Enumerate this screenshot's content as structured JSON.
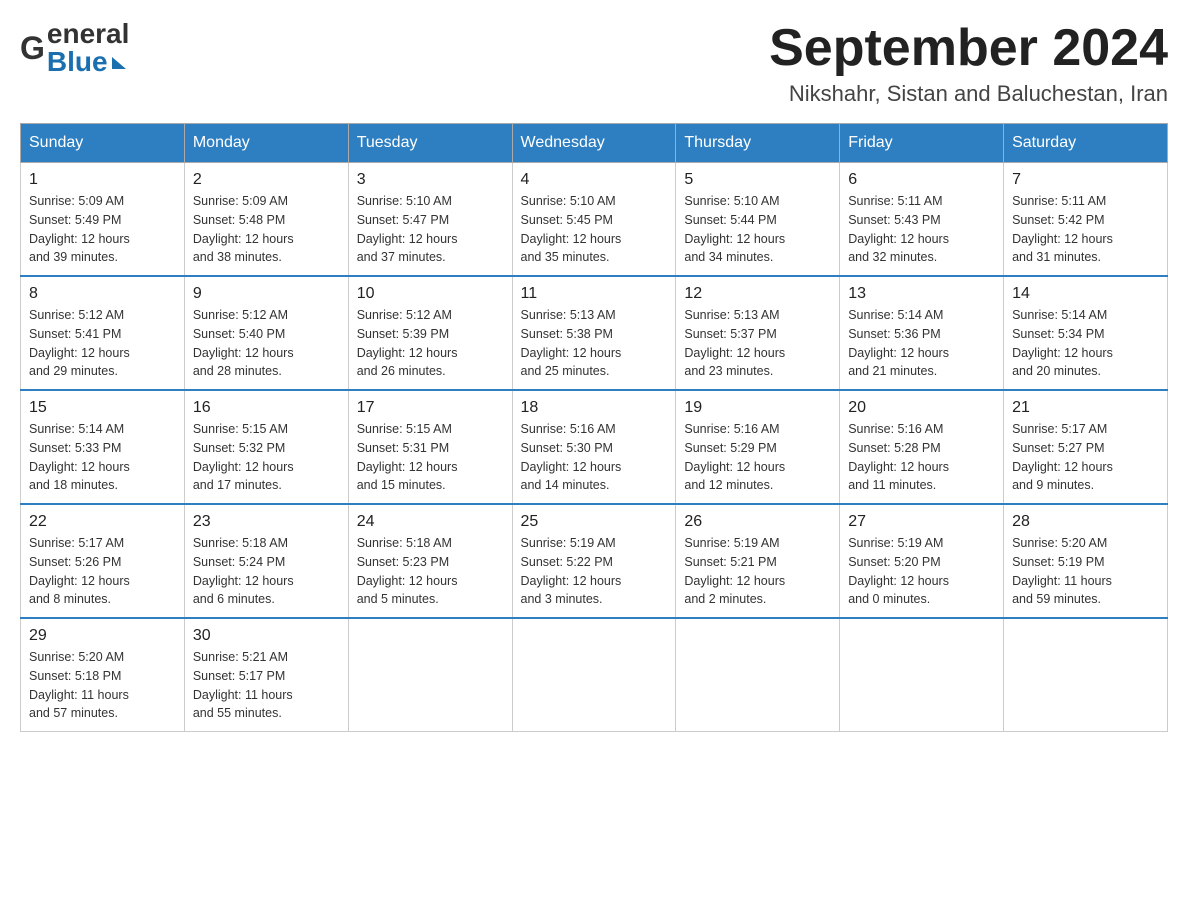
{
  "header": {
    "logo_general": "General",
    "logo_blue": "Blue",
    "title": "September 2024",
    "subtitle": "Nikshahr, Sistan and Baluchestan, Iran"
  },
  "calendar": {
    "weekdays": [
      "Sunday",
      "Monday",
      "Tuesday",
      "Wednesday",
      "Thursday",
      "Friday",
      "Saturday"
    ],
    "weeks": [
      [
        {
          "day": "1",
          "sunrise": "5:09 AM",
          "sunset": "5:49 PM",
          "daylight": "12 hours and 39 minutes."
        },
        {
          "day": "2",
          "sunrise": "5:09 AM",
          "sunset": "5:48 PM",
          "daylight": "12 hours and 38 minutes."
        },
        {
          "day": "3",
          "sunrise": "5:10 AM",
          "sunset": "5:47 PM",
          "daylight": "12 hours and 37 minutes."
        },
        {
          "day": "4",
          "sunrise": "5:10 AM",
          "sunset": "5:45 PM",
          "daylight": "12 hours and 35 minutes."
        },
        {
          "day": "5",
          "sunrise": "5:10 AM",
          "sunset": "5:44 PM",
          "daylight": "12 hours and 34 minutes."
        },
        {
          "day": "6",
          "sunrise": "5:11 AM",
          "sunset": "5:43 PM",
          "daylight": "12 hours and 32 minutes."
        },
        {
          "day": "7",
          "sunrise": "5:11 AM",
          "sunset": "5:42 PM",
          "daylight": "12 hours and 31 minutes."
        }
      ],
      [
        {
          "day": "8",
          "sunrise": "5:12 AM",
          "sunset": "5:41 PM",
          "daylight": "12 hours and 29 minutes."
        },
        {
          "day": "9",
          "sunrise": "5:12 AM",
          "sunset": "5:40 PM",
          "daylight": "12 hours and 28 minutes."
        },
        {
          "day": "10",
          "sunrise": "5:12 AM",
          "sunset": "5:39 PM",
          "daylight": "12 hours and 26 minutes."
        },
        {
          "day": "11",
          "sunrise": "5:13 AM",
          "sunset": "5:38 PM",
          "daylight": "12 hours and 25 minutes."
        },
        {
          "day": "12",
          "sunrise": "5:13 AM",
          "sunset": "5:37 PM",
          "daylight": "12 hours and 23 minutes."
        },
        {
          "day": "13",
          "sunrise": "5:14 AM",
          "sunset": "5:36 PM",
          "daylight": "12 hours and 21 minutes."
        },
        {
          "day": "14",
          "sunrise": "5:14 AM",
          "sunset": "5:34 PM",
          "daylight": "12 hours and 20 minutes."
        }
      ],
      [
        {
          "day": "15",
          "sunrise": "5:14 AM",
          "sunset": "5:33 PM",
          "daylight": "12 hours and 18 minutes."
        },
        {
          "day": "16",
          "sunrise": "5:15 AM",
          "sunset": "5:32 PM",
          "daylight": "12 hours and 17 minutes."
        },
        {
          "day": "17",
          "sunrise": "5:15 AM",
          "sunset": "5:31 PM",
          "daylight": "12 hours and 15 minutes."
        },
        {
          "day": "18",
          "sunrise": "5:16 AM",
          "sunset": "5:30 PM",
          "daylight": "12 hours and 14 minutes."
        },
        {
          "day": "19",
          "sunrise": "5:16 AM",
          "sunset": "5:29 PM",
          "daylight": "12 hours and 12 minutes."
        },
        {
          "day": "20",
          "sunrise": "5:16 AM",
          "sunset": "5:28 PM",
          "daylight": "12 hours and 11 minutes."
        },
        {
          "day": "21",
          "sunrise": "5:17 AM",
          "sunset": "5:27 PM",
          "daylight": "12 hours and 9 minutes."
        }
      ],
      [
        {
          "day": "22",
          "sunrise": "5:17 AM",
          "sunset": "5:26 PM",
          "daylight": "12 hours and 8 minutes."
        },
        {
          "day": "23",
          "sunrise": "5:18 AM",
          "sunset": "5:24 PM",
          "daylight": "12 hours and 6 minutes."
        },
        {
          "day": "24",
          "sunrise": "5:18 AM",
          "sunset": "5:23 PM",
          "daylight": "12 hours and 5 minutes."
        },
        {
          "day": "25",
          "sunrise": "5:19 AM",
          "sunset": "5:22 PM",
          "daylight": "12 hours and 3 minutes."
        },
        {
          "day": "26",
          "sunrise": "5:19 AM",
          "sunset": "5:21 PM",
          "daylight": "12 hours and 2 minutes."
        },
        {
          "day": "27",
          "sunrise": "5:19 AM",
          "sunset": "5:20 PM",
          "daylight": "12 hours and 0 minutes."
        },
        {
          "day": "28",
          "sunrise": "5:20 AM",
          "sunset": "5:19 PM",
          "daylight": "11 hours and 59 minutes."
        }
      ],
      [
        {
          "day": "29",
          "sunrise": "5:20 AM",
          "sunset": "5:18 PM",
          "daylight": "11 hours and 57 minutes."
        },
        {
          "day": "30",
          "sunrise": "5:21 AM",
          "sunset": "5:17 PM",
          "daylight": "11 hours and 55 minutes."
        },
        null,
        null,
        null,
        null,
        null
      ]
    ],
    "sunrise_label": "Sunrise:",
    "sunset_label": "Sunset:",
    "daylight_label": "Daylight:"
  }
}
